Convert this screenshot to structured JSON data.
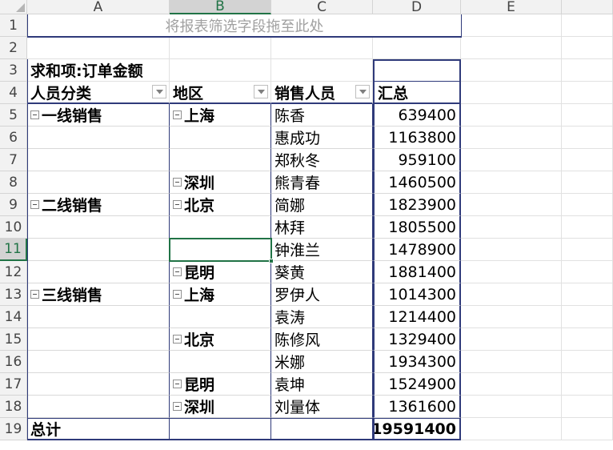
{
  "columns": [
    "A",
    "B",
    "C",
    "D",
    "E"
  ],
  "rows": [
    "1",
    "2",
    "3",
    "4",
    "5",
    "6",
    "7",
    "8",
    "9",
    "10",
    "11",
    "12",
    "13",
    "14",
    "15",
    "16",
    "17",
    "18",
    "19"
  ],
  "selected_cell": {
    "col": "B",
    "row": "11"
  },
  "pivot": {
    "filter_placeholder": "将报表筛选字段拖至此处",
    "value_header": "求和项:订单金额",
    "row_headers": {
      "a": "人员分类",
      "b": "地区",
      "c": "销售人员",
      "d": "汇总"
    },
    "data_rows": [
      {
        "a": "一线销售",
        "b": "上海",
        "c": "陈香",
        "d": "639400"
      },
      {
        "a": "",
        "b": "",
        "c": "惠成功",
        "d": "1163800"
      },
      {
        "a": "",
        "b": "",
        "c": "郑秋冬",
        "d": "959100"
      },
      {
        "a": "",
        "b": "深圳",
        "c": "熊青春",
        "d": "1460500"
      },
      {
        "a": "二线销售",
        "b": "北京",
        "c": "简娜",
        "d": "1823900"
      },
      {
        "a": "",
        "b": "",
        "c": "林拜",
        "d": "1805500"
      },
      {
        "a": "",
        "b": "",
        "c": "钟淮兰",
        "d": "1478900"
      },
      {
        "a": "",
        "b": "昆明",
        "c": "葵黄",
        "d": "1881400"
      },
      {
        "a": "三线销售",
        "b": "上海",
        "c": "罗伊人",
        "d": "1014300"
      },
      {
        "a": "",
        "b": "",
        "c": "袁涛",
        "d": "1214400"
      },
      {
        "a": "",
        "b": "北京",
        "c": "陈修风",
        "d": "1329400"
      },
      {
        "a": "",
        "b": "",
        "c": "米娜",
        "d": "1934300"
      },
      {
        "a": "",
        "b": "昆明",
        "c": "袁坤",
        "d": "1524900"
      },
      {
        "a": "",
        "b": "深圳",
        "c": "刘量体",
        "d": "1361600"
      }
    ],
    "total_label": "总计",
    "total_value": "19591400"
  }
}
